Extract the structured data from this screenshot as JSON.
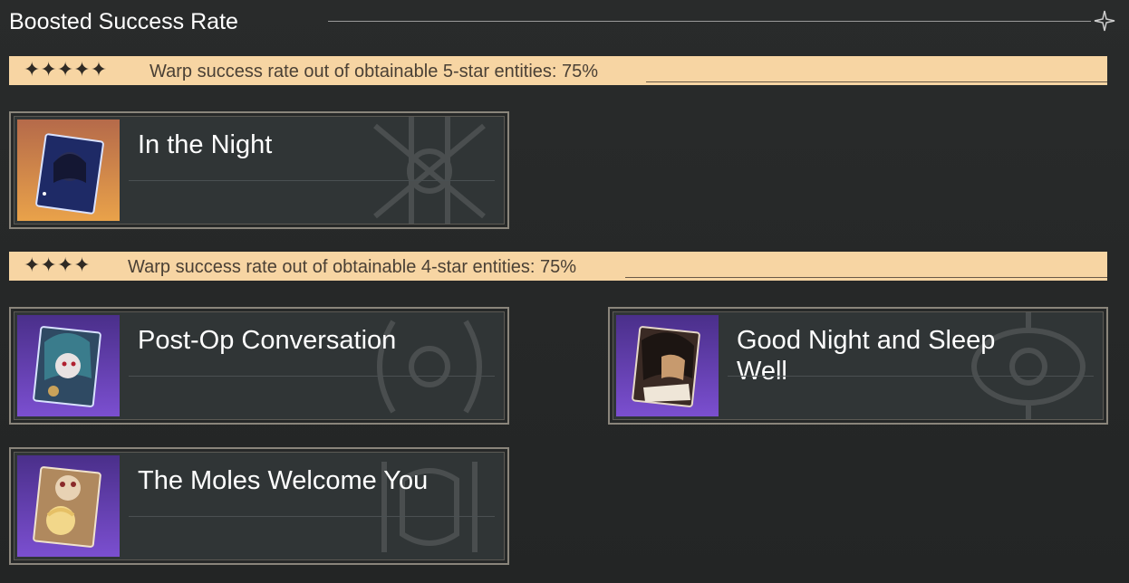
{
  "header": {
    "title": "Boosted Success Rate"
  },
  "five_star": {
    "stars": "✦✦✦✦✦",
    "text": "Warp success rate out of obtainable 5-star entities: 75%"
  },
  "four_star": {
    "stars": "✦✦✦✦",
    "text": "Warp success rate out of obtainable 4-star entities: 75%"
  },
  "cards": [
    {
      "title": "In the Night",
      "frame": "orange",
      "colors": {
        "bg_top": "#b56a4a",
        "bg_bottom": "#e9a24a"
      }
    },
    {
      "title": "Post-Op Conversation",
      "frame": "purple",
      "colors": {
        "bg_top": "#5b3ea8",
        "bg_bottom": "#7b4fd0"
      }
    },
    {
      "title": "Good Night and Sleep Well",
      "frame": "purple",
      "colors": {
        "bg_top": "#5b3ea8",
        "bg_bottom": "#7b4fd0"
      }
    },
    {
      "title": "The Moles Welcome You",
      "frame": "purple",
      "colors": {
        "bg_top": "#5b3ea8",
        "bg_bottom": "#7b4fd0"
      }
    }
  ]
}
